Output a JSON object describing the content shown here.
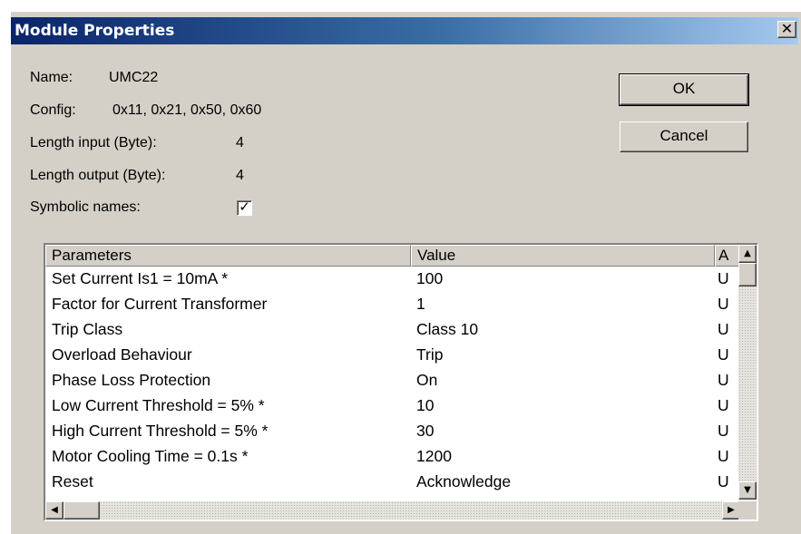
{
  "window": {
    "title": "Module Properties",
    "close_glyph": "✕"
  },
  "info": {
    "name_label": "Name:",
    "name_value": "UMC22",
    "config_label": "Config:",
    "config_value": "0x11, 0x21, 0x50, 0x60",
    "length_input_label": "Length input (Byte):",
    "length_input_value": "4",
    "length_output_label": "Length output (Byte):",
    "length_output_value": "4",
    "symbolic_names_label": "Symbolic names:",
    "symbolic_names_checked": true,
    "check_glyph": "✓"
  },
  "buttons": {
    "ok": "OK",
    "cancel": "Cancel"
  },
  "table": {
    "columns": [
      "Parameters",
      "Value",
      "A"
    ],
    "rows": [
      [
        "Set Current Is1 = 10mA *",
        "100",
        "U"
      ],
      [
        "Factor for Current Transformer",
        "1",
        "U"
      ],
      [
        "Trip Class",
        "Class 10",
        "U"
      ],
      [
        "Overload Behaviour",
        "Trip",
        "U"
      ],
      [
        "Phase Loss Protection",
        "On",
        "U"
      ],
      [
        "Low Current Threshold = 5% *",
        "10",
        "U"
      ],
      [
        "High Current Threshold = 5% *",
        "30",
        "U"
      ],
      [
        "Motor Cooling Time = 0.1s *",
        "1200",
        "U"
      ],
      [
        "Reset",
        "Acknowledge",
        "U"
      ]
    ]
  },
  "scrollbars": {
    "up_arrow": "▲",
    "down_arrow": "▼",
    "left_arrow": "◀",
    "right_arrow": "▶"
  }
}
